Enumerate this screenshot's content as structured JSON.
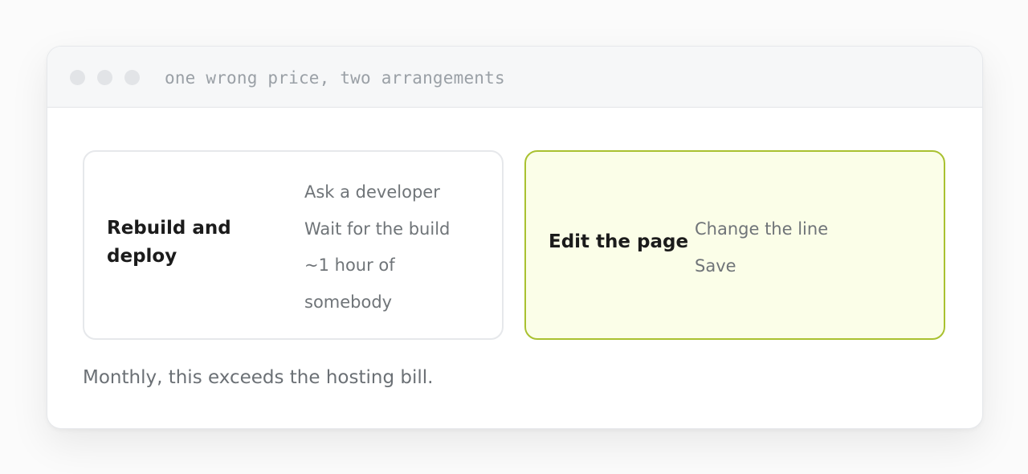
{
  "window": {
    "title": "one wrong price, two arrangements"
  },
  "cards": [
    {
      "title": "Rebuild and deploy",
      "steps": [
        "Ask a developer",
        "Wait for the build",
        "~1 hour of somebody"
      ],
      "border_color": "#e6e8eb",
      "background": "#ffffff"
    },
    {
      "title": "Edit the page",
      "steps": [
        "Change the line",
        "Save"
      ],
      "border_color": "#a9c130",
      "background": "#fbfee8"
    }
  ],
  "footnote": "Monthly, this exceeds the hosting bill."
}
